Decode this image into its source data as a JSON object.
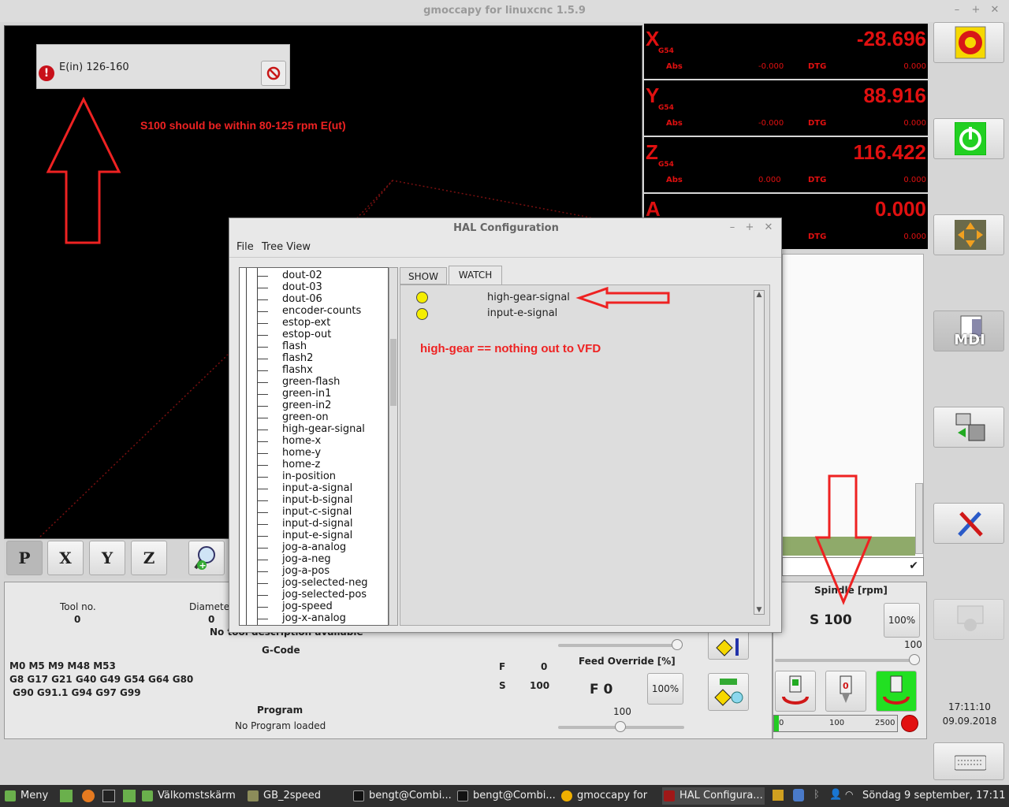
{
  "window": {
    "title": "gmoccapy for linuxcnc  1.5.9"
  },
  "error": {
    "message": "E(in) 126-160"
  },
  "annotations": {
    "note1": "S100 should be within 80-125 rpm E(ut)",
    "note2": "high-gear  == nothing out to VFD"
  },
  "dro": [
    {
      "axis": "X",
      "coord": "G54",
      "value": "-28.696",
      "abs_label": "Abs",
      "abs": "-0.000",
      "dtg_label": "DTG",
      "dtg": "0.000"
    },
    {
      "axis": "Y",
      "coord": "G54",
      "value": "88.916",
      "abs_label": "Abs",
      "abs": "-0.000",
      "dtg_label": "DTG",
      "dtg": "0.000"
    },
    {
      "axis": "Z",
      "coord": "G54",
      "value": "116.422",
      "abs_label": "Abs",
      "abs": "0.000",
      "dtg_label": "DTG",
      "dtg": "0.000"
    },
    {
      "axis": "A",
      "coord": "",
      "value": "0.000",
      "abs_label": "",
      "abs": "",
      "dtg_label": "DTG",
      "dtg": "0.000"
    }
  ],
  "right_buttons": {
    "mdi_label": "MDI"
  },
  "view_buttons": [
    "P",
    "X",
    "Y",
    "Z"
  ],
  "info": {
    "tool_label": "Tool no.",
    "tool_value": "0",
    "diameter_label": "Diamete",
    "diameter_value": "0",
    "tool_desc": "No tool description available",
    "gcode_label": "G-Code",
    "gcodes_line1": "M0 M5 M9 M48 M53",
    "gcodes_line2": "G8 G17 G21 G40 G49 G54 G64 G80",
    "gcodes_line3": " G90 G91.1 G94 G97 G99",
    "f_label": "F",
    "f_value": "0",
    "s_label": "S",
    "s_value": "100",
    "program_label": "Program",
    "program_value": "No Program loaded"
  },
  "feed": {
    "label": "Feed Override [%]",
    "display": "F  0",
    "reset_label": "100%",
    "value": "100"
  },
  "spindle": {
    "label": "Spindle [rpm]",
    "display": "S 100",
    "reset_label": "100%",
    "override_value": "100",
    "bar_min": "0",
    "bar_mid": "100",
    "bar_max": "2500"
  },
  "clock": {
    "time": "17:11:10",
    "date": "09.09.2018"
  },
  "hal": {
    "title": "HAL Configuration",
    "menu": [
      "File",
      "Tree View"
    ],
    "tabs": [
      "SHOW",
      "WATCH"
    ],
    "tree": [
      "dout-02",
      "dout-03",
      "dout-06",
      "encoder-counts",
      "estop-ext",
      "estop-out",
      "flash",
      "flash2",
      "flashx",
      "green-flash",
      "green-in1",
      "green-in2",
      "green-on",
      "high-gear-signal",
      "home-x",
      "home-y",
      "home-z",
      "in-position",
      "input-a-signal",
      "input-b-signal",
      "input-c-signal",
      "input-d-signal",
      "input-e-signal",
      "jog-a-analog",
      "jog-a-neg",
      "jog-a-pos",
      "jog-selected-neg",
      "jog-selected-pos",
      "jog-speed",
      "jog-x-analog"
    ],
    "watch": [
      "high-gear-signal",
      "input-e-signal"
    ]
  },
  "taskbar": {
    "menu": "Meny",
    "tasks": [
      "Välkomstskärm",
      "GB_2speed",
      "bengt@Combi...",
      "bengt@Combi...",
      "gmoccapy for l...",
      "HAL Configura..."
    ],
    "clock": "Söndag  9 september, 17:11"
  }
}
